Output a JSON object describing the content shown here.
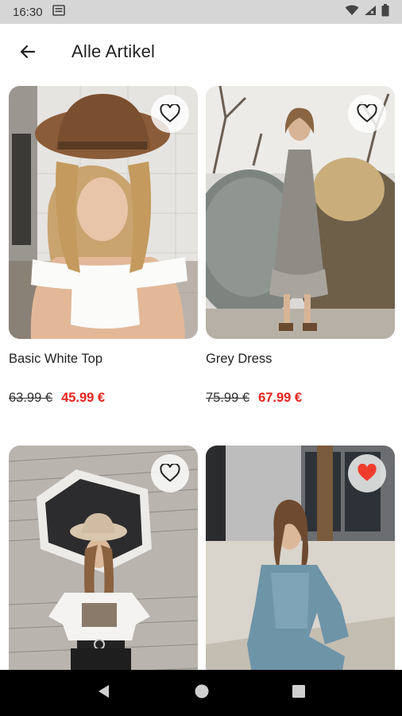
{
  "status_bar": {
    "time": "16:30"
  },
  "header": {
    "title": "Alle Artikel"
  },
  "products": [
    {
      "name": "Basic White Top",
      "old_price": "63.99 €",
      "new_price": "45.99 €",
      "favorite": false
    },
    {
      "name": "Grey Dress",
      "old_price": "75.99 €",
      "new_price": "67.99 €",
      "favorite": false
    },
    {
      "name": "",
      "old_price": "",
      "new_price": "",
      "favorite": false
    },
    {
      "name": "",
      "old_price": "",
      "new_price": "",
      "favorite": true
    }
  ],
  "colors": {
    "accent_red": "#e8231e",
    "favorite_red": "#f03c2d",
    "status_bar_bg": "#d6d6d6",
    "nav_bar_bg": "#000000"
  },
  "icons": {
    "back": "arrow-left-icon",
    "favorite": "heart-outline-icon",
    "favorite_active": "heart-filled-icon",
    "nav_back": "triangle-back-icon",
    "nav_home": "circle-home-icon",
    "nav_recents": "square-recents-icon"
  }
}
